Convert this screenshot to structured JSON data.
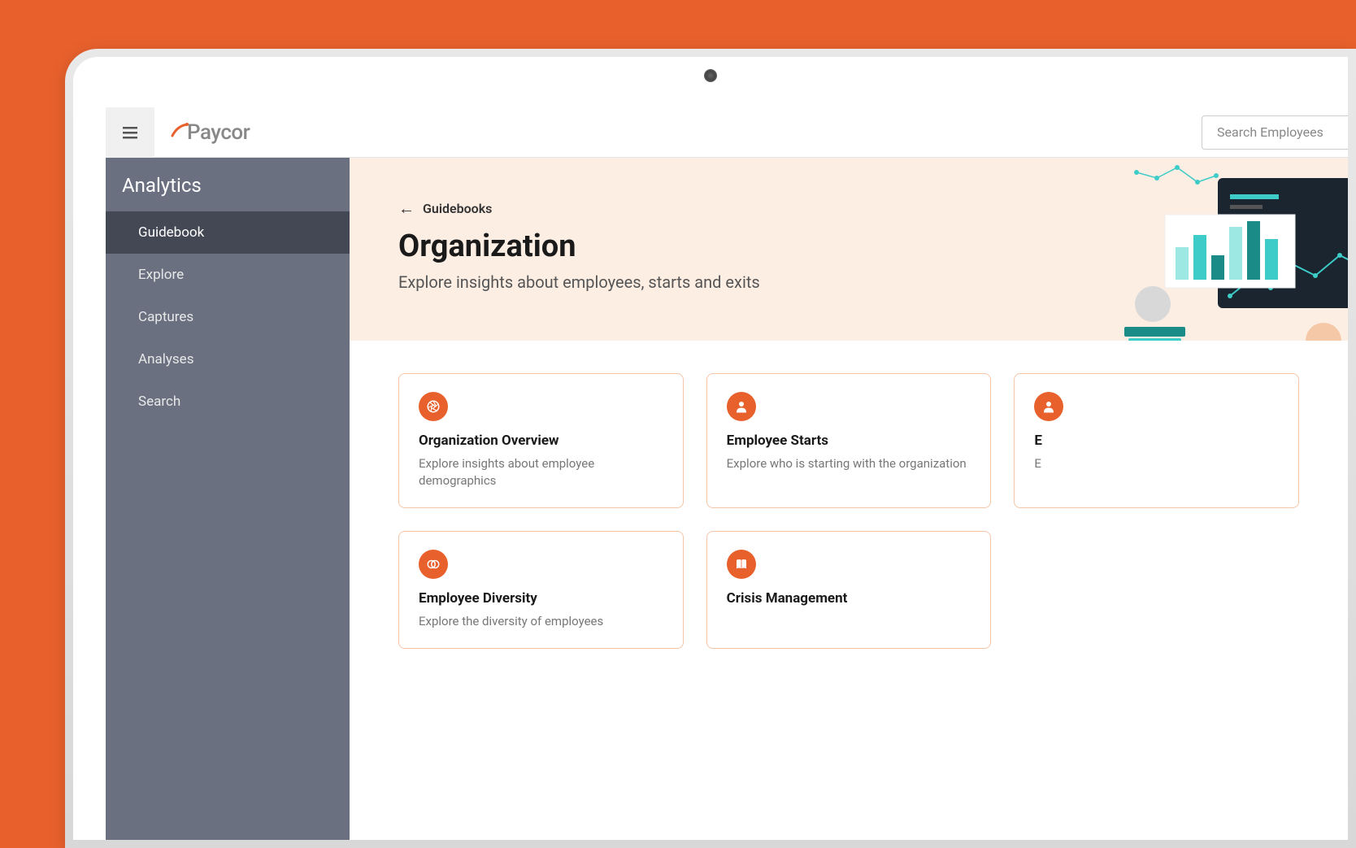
{
  "header": {
    "logo_text": "Paycor",
    "search_placeholder": "Search Employees"
  },
  "sidebar": {
    "title": "Analytics",
    "items": [
      {
        "label": "Guidebook",
        "active": true
      },
      {
        "label": "Explore",
        "active": false
      },
      {
        "label": "Captures",
        "active": false
      },
      {
        "label": "Analyses",
        "active": false
      },
      {
        "label": "Search",
        "active": false
      }
    ]
  },
  "hero": {
    "breadcrumb": "Guidebooks",
    "title": "Organization",
    "subtitle": "Explore insights about employees, starts and exits"
  },
  "cards": [
    {
      "title": "Organization Overview",
      "desc": "Explore insights about employee demographics",
      "icon": "aperture"
    },
    {
      "title": "Employee Starts",
      "desc": "Explore who is starting with the organization",
      "icon": "person"
    },
    {
      "title": "E",
      "desc": "E",
      "icon": "person"
    },
    {
      "title": "Employee Diversity",
      "desc": "Explore the diversity of employees",
      "icon": "overlap"
    },
    {
      "title": "Crisis Management",
      "desc": "",
      "icon": "book"
    }
  ],
  "colors": {
    "brand": "#e8612c",
    "sidebar_bg": "#6a7080",
    "sidebar_active": "#444854",
    "hero_bg": "#fdeee4",
    "card_border": "#f5c5a8",
    "teal": "#3dccc7"
  }
}
